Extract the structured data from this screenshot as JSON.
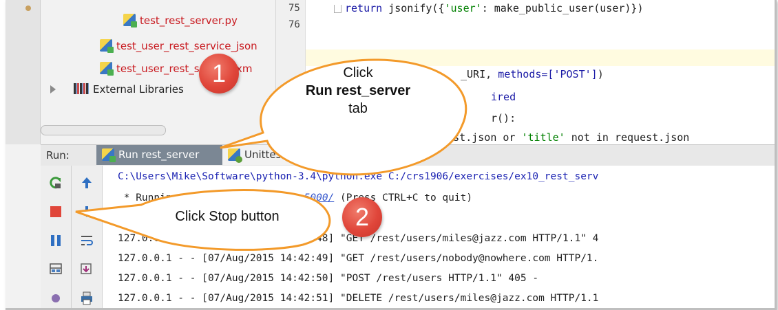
{
  "project_tree": {
    "items": [
      {
        "label": "test_rest_server.py"
      },
      {
        "label": "test_user_rest_service_json"
      },
      {
        "label": "test_user_rest_service_xm"
      },
      {
        "label": "External Libraries"
      }
    ]
  },
  "editor": {
    "line_numbers": [
      "75",
      "76"
    ],
    "code_lines": [
      {
        "a": "return",
        "b": " jsonify({",
        "c": "'user'",
        "d": ": make_public_user(user)})"
      },
      {
        "a": "",
        "b": "",
        "c": "",
        "d": ""
      },
      {
        "a": "",
        "b": "",
        "c": "",
        "d": ""
      },
      {
        "a": "",
        "b": "_URI, ",
        "c": "methods=['POST']",
        "d": ")"
      },
      {
        "a": "",
        "b": "ired",
        "c": "",
        "d": ""
      },
      {
        "a": "",
        "b": "r():",
        "c": "",
        "d": ""
      },
      {
        "a": "",
        "b": "request.json or ",
        "c": "'title'",
        "d": " not in request.json"
      }
    ]
  },
  "run_panel": {
    "label": "Run:",
    "tabs": [
      {
        "label": "Run rest_server",
        "active": true
      },
      {
        "label": "Unittest test_rest_server",
        "active": false
      }
    ]
  },
  "console": {
    "lines": [
      {
        "text": "C:\\Users\\Mike\\Software\\python-3.4\\python.exe C:/crs1906/exercises/ex10_rest_serv",
        "style": "blue"
      },
      {
        "prefix": " * Running on http://1",
        "link": "27.0.0.1:5000/",
        "suffix": " (Press CTRL+C to quit)",
        "style": "mixed"
      },
      {
        "text": "",
        "style": "plain"
      },
      {
        "text": "127.0.0.1 - - [07/Aug/2015 14:42:48] \"GET /rest/users/miles@jazz.com HTTP/1.1\" 4",
        "style": "plain"
      },
      {
        "text": "127.0.0.1 - - [07/Aug/2015 14:42:49] \"GET /rest/users/nobody@nowhere.com HTTP/1.",
        "style": "plain"
      },
      {
        "text": "127.0.0.1 - - [07/Aug/2015 14:42:50] \"POST /rest/users HTTP/1.1\" 405 -",
        "style": "plain"
      },
      {
        "text": "127.0.0.1 - - [07/Aug/2015 14:42:51] \"DELETE /rest/users/miles@jazz.com HTTP/1.1",
        "style": "plain"
      }
    ]
  },
  "callouts": {
    "one": {
      "line1": "Click",
      "line2": "Run rest_server",
      "line3": "tab",
      "badge": "1"
    },
    "two": {
      "text": "Click Stop button",
      "badge": "2"
    }
  },
  "colors": {
    "stop_red": "#e0463a",
    "rerun_green": "#3c9a3c",
    "pause_blue": "#2e6fc2",
    "active_tab": "#7b8794",
    "callout_border": "#f39a2a"
  }
}
